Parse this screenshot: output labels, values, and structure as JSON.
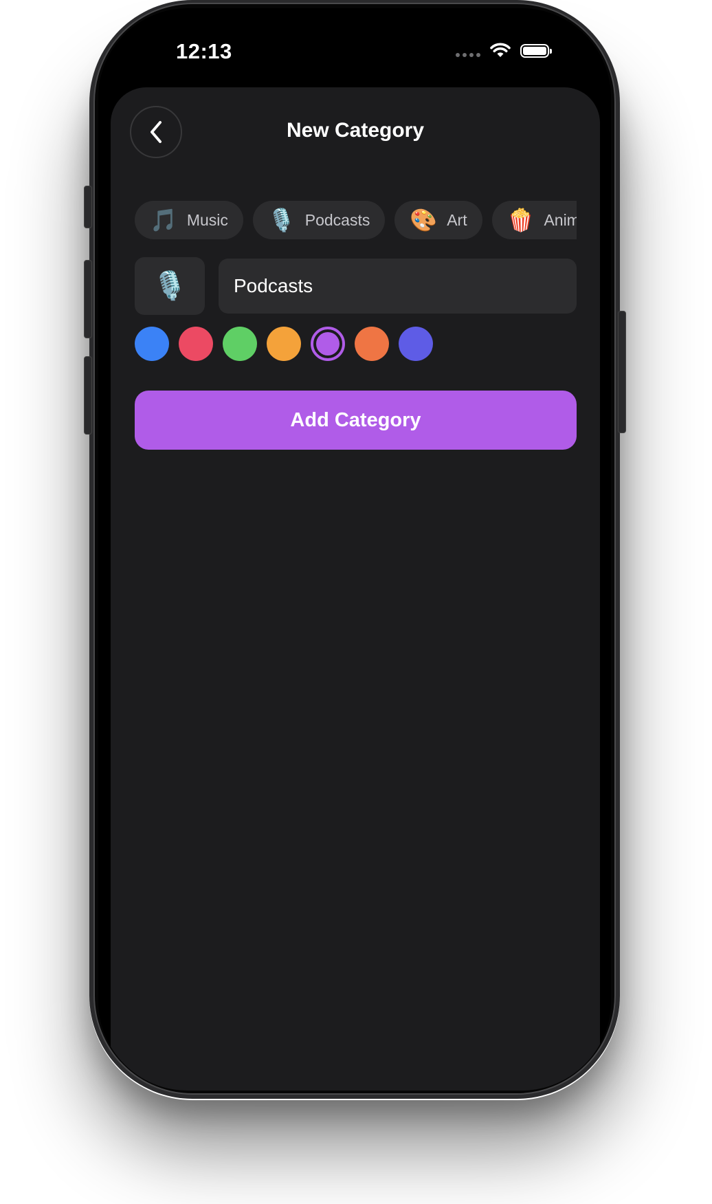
{
  "status_bar": {
    "time": "12:13"
  },
  "header": {
    "title": "New Category",
    "back_icon": "chevron-left-icon"
  },
  "presets": [
    {
      "emoji": "🎵",
      "label": "Music"
    },
    {
      "emoji": "🎙️",
      "label": "Podcasts"
    },
    {
      "emoji": "🎨",
      "label": "Art"
    },
    {
      "emoji": "🍿",
      "label": "Anime"
    }
  ],
  "form": {
    "selected_emoji": "🎙️",
    "name_value": "Podcasts"
  },
  "colors": {
    "swatches": [
      "#3b82f6",
      "#ec4a63",
      "#5fcf65",
      "#f4a23a",
      "#b05ce8",
      "#ef7544",
      "#5e5ce6"
    ],
    "selected_index": 4,
    "accent": "#b05ce8"
  },
  "add_button": {
    "label": "Add Category"
  }
}
